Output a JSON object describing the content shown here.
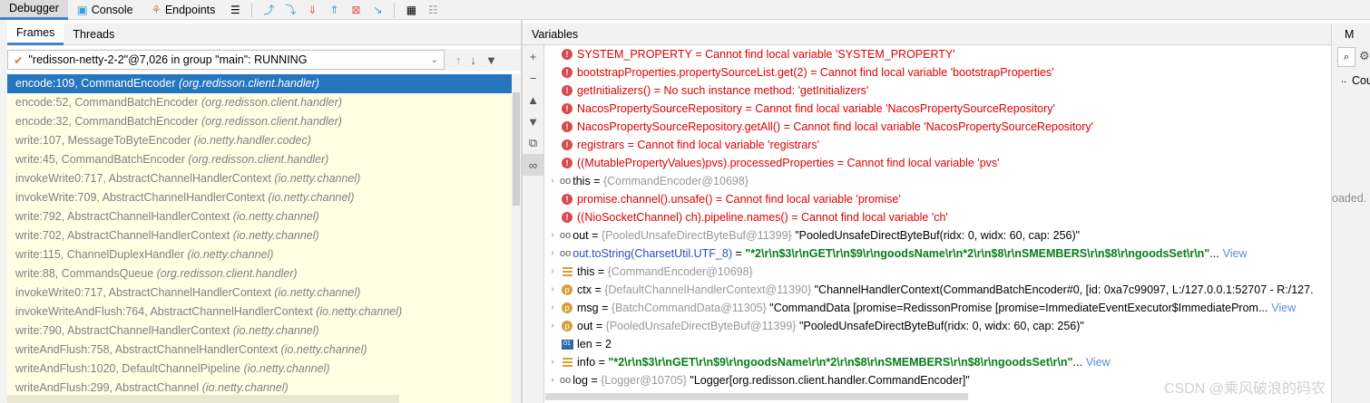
{
  "toolbar": {
    "tabs": [
      {
        "label": "Debugger",
        "active": true
      },
      {
        "label": "Console",
        "active": false
      },
      {
        "label": "Endpoints",
        "active": false
      }
    ]
  },
  "frames_panel": {
    "tabs": [
      "Frames",
      "Threads"
    ],
    "thread": "\"redisson-netty-2-2\"@7,026 in group \"main\": RUNNING",
    "frames": [
      {
        "method": "encode:109, CommandEncoder",
        "pkg": "(org.redisson.client.handler)",
        "selected": true
      },
      {
        "method": "encode:52, CommandBatchEncoder",
        "pkg": "(org.redisson.client.handler)"
      },
      {
        "method": "encode:32, CommandBatchEncoder",
        "pkg": "(org.redisson.client.handler)"
      },
      {
        "method": "write:107, MessageToByteEncoder",
        "pkg": "(io.netty.handler.codec)"
      },
      {
        "method": "write:45, CommandBatchEncoder",
        "pkg": "(org.redisson.client.handler)"
      },
      {
        "method": "invokeWrite0:717, AbstractChannelHandlerContext",
        "pkg": "(io.netty.channel)"
      },
      {
        "method": "invokeWrite:709, AbstractChannelHandlerContext",
        "pkg": "(io.netty.channel)"
      },
      {
        "method": "write:792, AbstractChannelHandlerContext",
        "pkg": "(io.netty.channel)"
      },
      {
        "method": "write:702, AbstractChannelHandlerContext",
        "pkg": "(io.netty.channel)"
      },
      {
        "method": "write:115, ChannelDuplexHandler",
        "pkg": "(io.netty.channel)"
      },
      {
        "method": "write:88, CommandsQueue",
        "pkg": "(org.redisson.client.handler)"
      },
      {
        "method": "invokeWrite0:717, AbstractChannelHandlerContext",
        "pkg": "(io.netty.channel)"
      },
      {
        "method": "invokeWriteAndFlush:764, AbstractChannelHandlerContext",
        "pkg": "(io.netty.channel)"
      },
      {
        "method": "write:790, AbstractChannelHandlerContext",
        "pkg": "(io.netty.channel)"
      },
      {
        "method": "writeAndFlush:758, AbstractChannelHandlerContext",
        "pkg": "(io.netty.channel)"
      },
      {
        "method": "writeAndFlush:1020, DefaultChannelPipeline",
        "pkg": "(io.netty.channel)"
      },
      {
        "method": "writeAndFlush:299, AbstractChannel",
        "pkg": "(io.netty.channel)"
      }
    ]
  },
  "variables_panel": {
    "title": "Variables",
    "errors": [
      {
        "name": "SYSTEM_PROPERTY",
        "msg": "Cannot find local variable 'SYSTEM_PROPERTY'"
      },
      {
        "name": "bootstrapProperties.propertySourceList.get(2)",
        "msg": "Cannot find local variable 'bootstrapProperties'"
      },
      {
        "name": "getInitializers()",
        "msg": "No such instance method: 'getInitializers'"
      },
      {
        "name": "NacosPropertySourceRepository",
        "msg": "Cannot find local variable 'NacosPropertySourceRepository'"
      },
      {
        "name": "NacosPropertySourceRepository.getAll()",
        "msg": "Cannot find local variable 'NacosPropertySourceRepository'"
      },
      {
        "name": "registrars",
        "msg": "Cannot find local variable 'registrars'"
      },
      {
        "name": "((MutablePropertyValues)pvs).processedProperties",
        "msg": "Cannot find local variable 'pvs'"
      }
    ],
    "this_watch": {
      "name": "this",
      "type": "{CommandEncoder@10698}"
    },
    "errors2": [
      {
        "name": "promise.channel().unsafe()",
        "msg": "Cannot find local variable 'promise'"
      },
      {
        "name": "((NioSocketChannel) ch).pipeline.names()",
        "msg": "Cannot find local variable 'ch'"
      }
    ],
    "out_watch": {
      "name": "out",
      "type": "{PooledUnsafeDirectByteBuf@11399}",
      "value": "\"PooledUnsafeDirectByteBuf(ridx: 0, widx: 60, cap: 256)\""
    },
    "tostring_watch": {
      "name": "out.toString(CharsetUtil.UTF_8)",
      "value": "\"*2\\r\\n$3\\r\\nGET\\r\\n$9\\r\\ngoodsName\\r\\n*2\\r\\n$8\\r\\nSMEMBERS\\r\\n$8\\r\\ngoodsSet\\r\\n\"",
      "ellipsis": "...",
      "link": "View"
    },
    "this_local": {
      "name": "this",
      "type": "{CommandEncoder@10698}"
    },
    "ctx": {
      "name": "ctx",
      "type": "{DefaultChannelHandlerContext@11390}",
      "value": "\"ChannelHandlerContext(CommandBatchEncoder#0, [id: 0xa7c99097, L:/127.0.0.1:52707 - R:/127."
    },
    "msg": {
      "name": "msg",
      "type": "{BatchCommandData@11305}",
      "value": "\"CommandData [promise=RedissonPromise [promise=ImmediateEventExecutor$ImmediateProm...",
      "link": "View"
    },
    "out_local": {
      "name": "out",
      "type": "{PooledUnsafeDirectByteBuf@11399}",
      "value": "\"PooledUnsafeDirectByteBuf(ridx: 0, widx: 60, cap: 256)\""
    },
    "len": {
      "name": "len",
      "value": "2"
    },
    "info": {
      "name": "info",
      "value": "\"*2\\r\\n$3\\r\\nGET\\r\\n$9\\r\\ngoodsName\\r\\n*2\\r\\n$8\\r\\nSMEMBERS\\r\\n$8\\r\\ngoodsSet\\r\\n\"",
      "ellipsis": "...",
      "link": "View"
    },
    "log": {
      "name": "log",
      "type": "{Logger@10705}",
      "value": "\"Logger[org.redisson.client.handler.CommandEncoder]\""
    }
  },
  "right_panel": {
    "tab": "M",
    "col": "Cou",
    "dots": "..",
    "status": "oaded."
  },
  "watermark": "CSDN @乘风破浪的码农"
}
